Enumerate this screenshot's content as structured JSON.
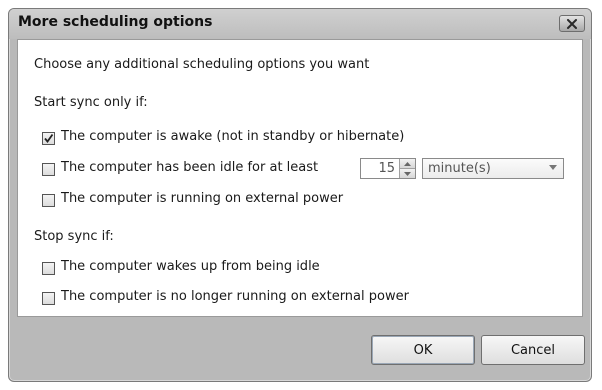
{
  "window": {
    "title": "More scheduling options",
    "close_icon": "close-icon"
  },
  "intro": "Choose any additional scheduling options you want",
  "start_section": {
    "heading": "Start sync only if:",
    "options": [
      {
        "label": "The computer is awake (not in standby or hibernate)",
        "checked": true
      },
      {
        "label": "The computer has been idle for at least",
        "checked": false
      },
      {
        "label": "The computer is running on external power",
        "checked": false
      }
    ],
    "idle_amount": "15",
    "idle_unit": "minute(s)"
  },
  "stop_section": {
    "heading": "Stop sync if:",
    "options": [
      {
        "label": "The computer wakes up from being idle",
        "checked": false
      },
      {
        "label": "The computer is no longer running on external power",
        "checked": false
      }
    ]
  },
  "buttons": {
    "ok": "OK",
    "cancel": "Cancel"
  }
}
